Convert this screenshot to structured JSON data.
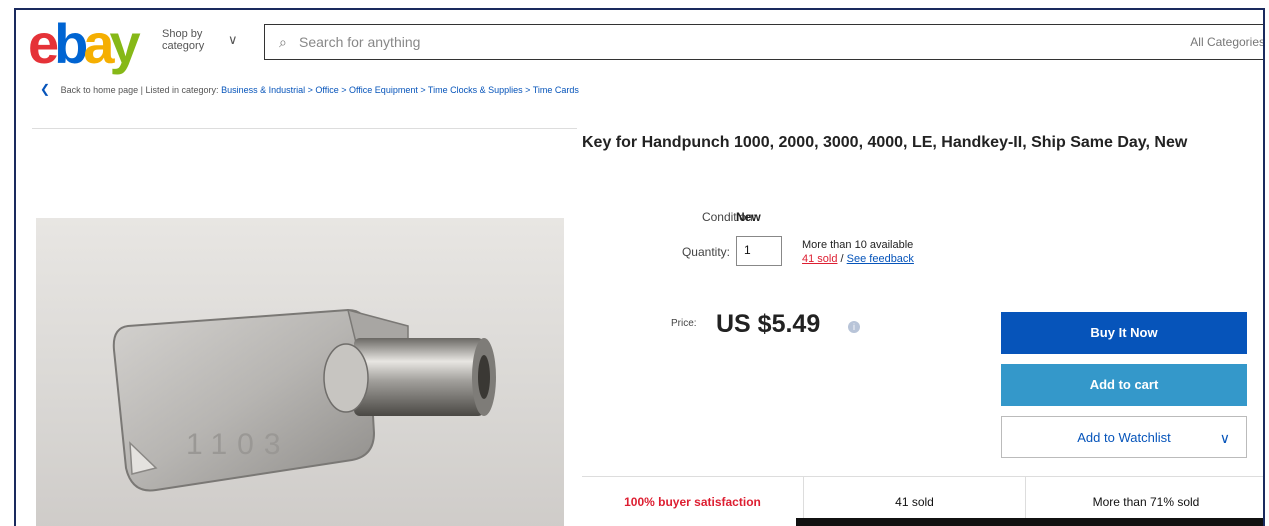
{
  "header": {
    "logo": {
      "e": "e",
      "b": "b",
      "a": "a",
      "y": "y"
    },
    "shop_by_category": "Shop by category",
    "search_placeholder": "Search for anything",
    "all_categories": "All Categories"
  },
  "breadcrumb": {
    "back": "Back to home page",
    "listed_in": "| Listed in category:",
    "path": "Business & Industrial > Office > Office Equipment > Time Clocks & Supplies > Time Cards"
  },
  "product": {
    "title": "Key for Handpunch 1000, 2000, 3000, 4000, LE, Handkey-II, Ship Same Day, New",
    "condition_label": "Condition:",
    "condition_value": "New",
    "quantity_label": "Quantity:",
    "quantity_value": "1",
    "availability": "More than 10 available",
    "sold": "41 sold",
    "feedback": "See feedback",
    "price_label": "Price:",
    "price": "US $5.49",
    "key_engraving": "1103"
  },
  "actions": {
    "buy_now": "Buy It Now",
    "add_to_cart": "Add to cart",
    "add_to_watchlist": "Add to Watchlist"
  },
  "highlights": [
    {
      "text": "100% buyer satisfaction"
    },
    {
      "text": "41 sold"
    },
    {
      "text": "More than 71% sold"
    }
  ],
  "colors": {
    "primary_blue": "#0654ba",
    "cart_blue": "#3498ca",
    "alert_red": "#dd1e31"
  }
}
